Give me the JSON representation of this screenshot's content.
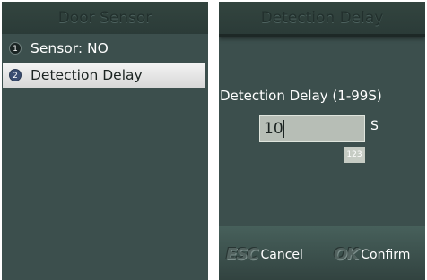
{
  "left_screen": {
    "title": "Door Sensor",
    "menu": [
      {
        "number": "1",
        "label": "Sensor: NO"
      },
      {
        "number": "2",
        "label": "Detection Delay"
      }
    ]
  },
  "right_screen": {
    "title": "Detection Delay",
    "field_label": "Detection Delay (1-99S)",
    "value": "10",
    "unit": "S",
    "input_mode": "123",
    "softkeys": {
      "esc_icon": "ESC",
      "esc_label": "Cancel",
      "ok_icon": "OK",
      "ok_label": "Confirm"
    }
  },
  "colors": {
    "screen_bg": "#3c4f4d",
    "highlight_bg": "#e8e8e8",
    "input_bg": "#b7beb6"
  }
}
